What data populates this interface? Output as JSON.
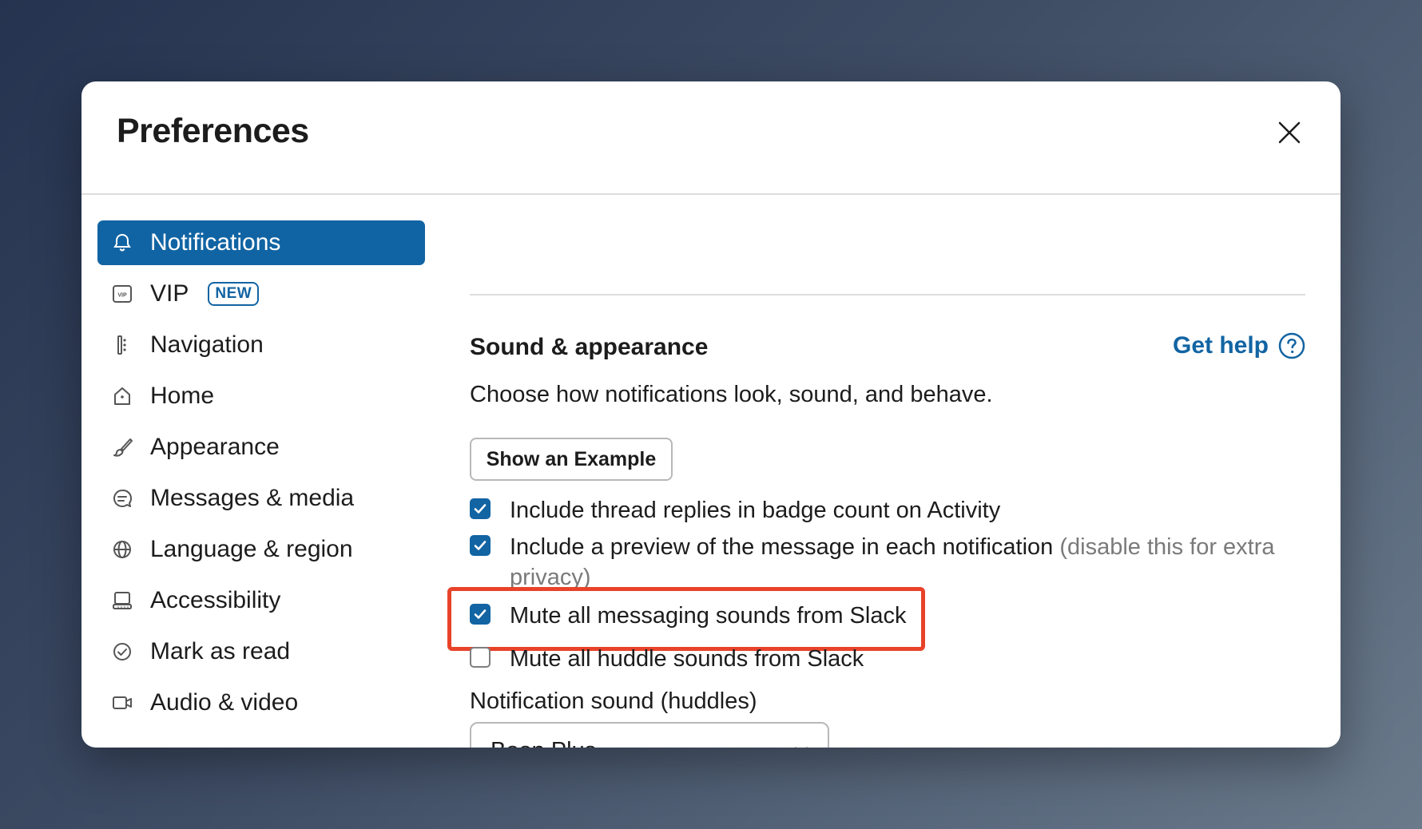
{
  "modal": {
    "title": "Preferences"
  },
  "sidebar": {
    "items": [
      {
        "label": "Notifications",
        "icon": "bell-icon",
        "active": true
      },
      {
        "label": "VIP",
        "icon": "vip-icon",
        "badge": "NEW"
      },
      {
        "label": "Navigation",
        "icon": "navigation-icon"
      },
      {
        "label": "Home",
        "icon": "home-icon"
      },
      {
        "label": "Appearance",
        "icon": "paintbrush-icon"
      },
      {
        "label": "Messages & media",
        "icon": "message-icon"
      },
      {
        "label": "Language & region",
        "icon": "globe-icon"
      },
      {
        "label": "Accessibility",
        "icon": "keyboard-icon"
      },
      {
        "label": "Mark as read",
        "icon": "check-circle-icon"
      },
      {
        "label": "Audio & video",
        "icon": "video-icon"
      }
    ]
  },
  "content": {
    "section_title": "Sound & appearance",
    "get_help": "Get help",
    "description": "Choose how notifications look, sound, and behave.",
    "example_button": "Show an Example",
    "checkboxes": [
      {
        "label": "Include thread replies in badge count on Activity",
        "checked": true
      },
      {
        "label": "Include a preview of the message in each notification",
        "note": "(disable this for extra privacy)",
        "checked": true
      },
      {
        "label": "Mute all messaging sounds from Slack",
        "checked": true,
        "highlighted": true
      },
      {
        "label": "Mute all huddle sounds from Slack",
        "checked": false
      }
    ],
    "huddle_sound": {
      "label": "Notification sound (huddles)",
      "value": "Boop Plus"
    }
  },
  "colors": {
    "accent": "#1264a3",
    "active_nav": "#1164a3",
    "highlight": "#e8432a"
  }
}
